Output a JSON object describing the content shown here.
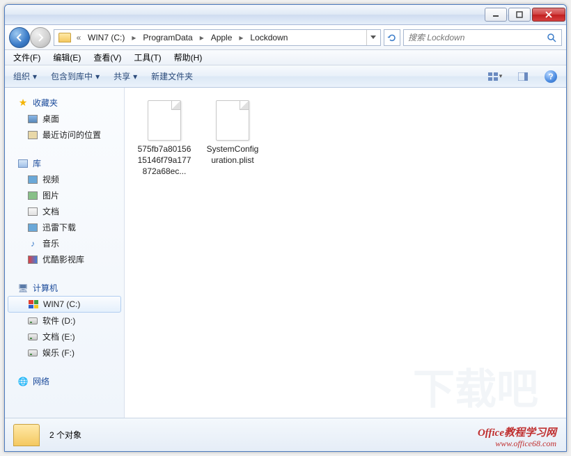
{
  "titlebar": {},
  "address": {
    "segments": [
      "WIN7 (C:)",
      "ProgramData",
      "Apple",
      "Lockdown"
    ],
    "prefix": "«"
  },
  "search": {
    "placeholder": "搜索 Lockdown"
  },
  "menu": {
    "file": "文件(F)",
    "edit": "编辑(E)",
    "view": "查看(V)",
    "tools": "工具(T)",
    "help": "帮助(H)"
  },
  "toolbar": {
    "organize": "组织",
    "include": "包含到库中",
    "share": "共享",
    "newfolder": "新建文件夹"
  },
  "sidebar": {
    "favorites": {
      "label": "收藏夹",
      "items": [
        "桌面",
        "最近访问的位置"
      ]
    },
    "libraries": {
      "label": "库",
      "items": [
        "视频",
        "图片",
        "文档",
        "迅雷下载",
        "音乐",
        "优酷影视库"
      ]
    },
    "computer": {
      "label": "计算机",
      "items": [
        "WIN7 (C:)",
        "软件 (D:)",
        "文档 (E:)",
        "娱乐 (F:)"
      ],
      "selected": 0
    },
    "network": {
      "label": "网络"
    }
  },
  "files": [
    {
      "name": "575fb7a8015615146f79a177872a68ec..."
    },
    {
      "name": "SystemConfiguration.plist"
    }
  ],
  "status": {
    "count": "2 个对象"
  },
  "watermark": {
    "l1": "Office教程学习网",
    "l2": "www.office68.com",
    "bg": "下载吧"
  }
}
